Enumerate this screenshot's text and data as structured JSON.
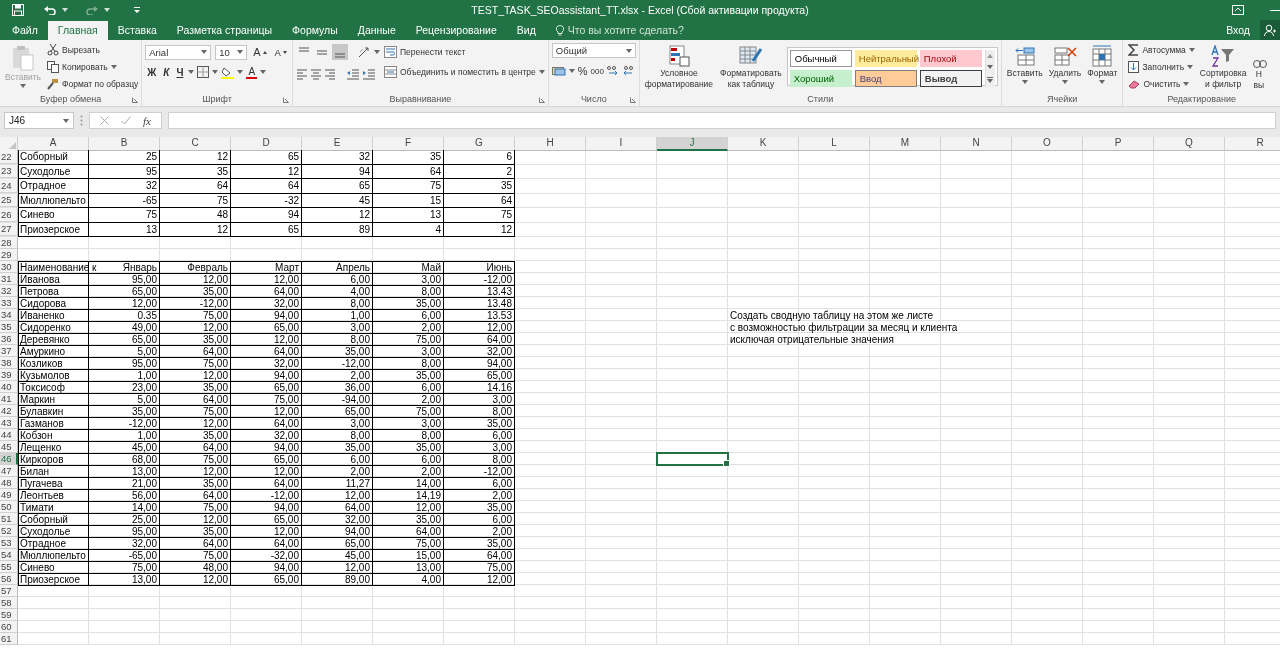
{
  "title_bar": {
    "title": "TEST_TASK_SEOassistant_TT.xlsx - Excel (Сбой активации продукта)"
  },
  "tabs": [
    {
      "label": "Файл",
      "selected": false
    },
    {
      "label": "Главная",
      "selected": true
    },
    {
      "label": "Вставка",
      "selected": false
    },
    {
      "label": "Разметка страницы",
      "selected": false
    },
    {
      "label": "Формулы",
      "selected": false
    },
    {
      "label": "Данные",
      "selected": false
    },
    {
      "label": "Рецензирование",
      "selected": false
    },
    {
      "label": "Вид",
      "selected": false
    }
  ],
  "tell_me": {
    "placeholder": "Что вы хотите сделать?"
  },
  "sign_in": "Вход",
  "ribbon": {
    "clipboard": {
      "paste": {
        "label": "Вставить",
        "disabled": true
      },
      "cut": "Вырезать",
      "copy": "Копировать",
      "format_painter": "Формат по образцу",
      "group_label": "Буфер обмена"
    },
    "font": {
      "name": "Arial",
      "size": "10",
      "grow": "A",
      "shrink": "A",
      "bold": "Ж",
      "italic": "К",
      "underline": "Ч",
      "font_color": "A",
      "group_label": "Шрифт"
    },
    "alignment": {
      "vertical_buttons": [
        {
          "selected": false
        },
        {
          "selected": false
        },
        {
          "selected": true
        }
      ],
      "wrap_text": "Перенести текст",
      "merge_center": "Объединить и поместить в центре",
      "group_label": "Выравнивание"
    },
    "number": {
      "format": "Общий",
      "percent": "%",
      "thousands": "000",
      "group_label": "Число"
    },
    "styles": {
      "conditional": "Условное\nформатирование",
      "format_table": "Форматировать\nкак таблицу",
      "cell_styles": [
        {
          "label": "Обычный",
          "kind": "normal"
        },
        {
          "label": "Нейтральный",
          "kind": "neutral"
        },
        {
          "label": "Плохой",
          "kind": "bad"
        },
        {
          "label": "Хороший",
          "kind": "good"
        },
        {
          "label": "Ввод",
          "kind": "input"
        },
        {
          "label": "Вывод",
          "kind": "output"
        }
      ],
      "group_label": "Стили"
    },
    "cells": {
      "insert": "Вставить",
      "delete": "Удалить",
      "format": "Формат",
      "group_label": "Ячейки"
    },
    "editing": {
      "autosum": "Автосумма",
      "fill": "Заполнить",
      "clear": "Очистить",
      "sort_filter": "Сортировка\nи фильтр",
      "find_select": "Н\nвы",
      "group_label": "Редактирование"
    }
  },
  "formula_bar": {
    "name_box": "J46",
    "function_label": "fx"
  },
  "sheet": {
    "columns": [
      {
        "label": "A",
        "selected": false
      },
      {
        "label": "B",
        "selected": false
      },
      {
        "label": "C",
        "selected": false
      },
      {
        "label": "D",
        "selected": false
      },
      {
        "label": "E",
        "selected": false
      },
      {
        "label": "F",
        "selected": false
      },
      {
        "label": "G",
        "selected": false
      },
      {
        "label": "H",
        "selected": false
      },
      {
        "label": "I",
        "selected": false
      },
      {
        "label": "J",
        "selected": true
      },
      {
        "label": "K",
        "selected": false
      },
      {
        "label": "L",
        "selected": false
      },
      {
        "label": "M",
        "selected": false
      },
      {
        "label": "N",
        "selected": false
      },
      {
        "label": "O",
        "selected": false
      },
      {
        "label": "P",
        "selected": false
      },
      {
        "label": "Q",
        "selected": false
      },
      {
        "label": "R",
        "selected": false
      }
    ],
    "rows": [
      {
        "number": "22",
        "kind": "block",
        "selected": false,
        "cells": {
          "A": "Соборный",
          "B": "25",
          "C": "12",
          "D": "65",
          "E": "32",
          "F": "35",
          "G": "6"
        }
      },
      {
        "number": "23",
        "kind": "block",
        "selected": false,
        "cells": {
          "A": "Суходолье",
          "B": "95",
          "C": "35",
          "D": "12",
          "E": "94",
          "F": "64",
          "G": "2"
        }
      },
      {
        "number": "24",
        "kind": "block",
        "selected": false,
        "cells": {
          "A": "Отрадное",
          "B": "32",
          "C": "64",
          "D": "64",
          "E": "65",
          "F": "75",
          "G": "35"
        }
      },
      {
        "number": "25",
        "kind": "block",
        "selected": false,
        "cells": {
          "A": "Мюллюпельто",
          "B": "-65",
          "C": "75",
          "D": "-32",
          "E": "45",
          "F": "15",
          "G": "64"
        }
      },
      {
        "number": "26",
        "kind": "block",
        "selected": false,
        "cells": {
          "A": "Синево",
          "B": "75",
          "C": "48",
          "D": "94",
          "E": "12",
          "F": "13",
          "G": "75"
        }
      },
      {
        "number": "27",
        "kind": "block",
        "selected": false,
        "cells": {
          "A": "Приозерское",
          "B": "13",
          "C": "12",
          "D": "65",
          "E": "89",
          "F": "4",
          "G": "12"
        }
      },
      {
        "number": "28",
        "kind": "empty",
        "selected": false
      },
      {
        "number": "29",
        "kind": "empty",
        "selected": false
      },
      {
        "number": "30",
        "kind": "table",
        "selected": false,
        "cells": {
          "A": "Наименование к",
          "B": "Январь",
          "C": "Февраль",
          "D": "Март",
          "E": "Апрель",
          "F": "Май",
          "G": "Июнь"
        }
      },
      {
        "number": "31",
        "kind": "table",
        "selected": false,
        "cells": {
          "A": "Иванова",
          "B": "95,00",
          "C": "12,00",
          "D": "12,00",
          "E": "6,00",
          "F": "3,00",
          "G": "-12,00"
        }
      },
      {
        "number": "32",
        "kind": "table",
        "selected": false,
        "cells": {
          "A": "Петрова",
          "B": "65,00",
          "C": "35,00",
          "D": "64,00",
          "E": "4,00",
          "F": "8,00",
          "G": "13.43"
        }
      },
      {
        "number": "33",
        "kind": "table",
        "selected": false,
        "cells": {
          "A": "Сидорова",
          "B": "12,00",
          "C": "-12,00",
          "D": "32,00",
          "E": "8,00",
          "F": "35,00",
          "G": "13.48"
        }
      },
      {
        "number": "34",
        "kind": "table",
        "selected": false,
        "cells": {
          "A": "Иваненко",
          "B": "0.35",
          "C": "75,00",
          "D": "94,00",
          "E": "1,00",
          "F": "6,00",
          "G": "13.53",
          "K": "Создать сводную таблицу на этом же листе"
        }
      },
      {
        "number": "35",
        "kind": "table",
        "selected": false,
        "cells": {
          "A": "Сидоренко",
          "B": "49,00",
          "C": "12,00",
          "D": "65,00",
          "E": "3,00",
          "F": "2,00",
          "G": "12,00",
          "K": "с возможностью фильтрации за месяц и клиента"
        }
      },
      {
        "number": "36",
        "kind": "table",
        "selected": false,
        "cells": {
          "A": "Деревянко",
          "B": "65,00",
          "C": "35,00",
          "D": "12,00",
          "E": "8,00",
          "F": "75,00",
          "G": "64,00",
          "K": "исключая отрицательные значения"
        }
      },
      {
        "number": "37",
        "kind": "table",
        "selected": false,
        "cells": {
          "A": "Амуркино",
          "B": "5,00",
          "C": "64,00",
          "D": "64,00",
          "E": "35,00",
          "F": "3,00",
          "G": "32,00"
        }
      },
      {
        "number": "38",
        "kind": "table",
        "selected": false,
        "cells": {
          "A": "Козликов",
          "B": "95,00",
          "C": "75,00",
          "D": "32,00",
          "E": "-12,00",
          "F": "8,00",
          "G": "94,00"
        }
      },
      {
        "number": "39",
        "kind": "table",
        "selected": false,
        "cells": {
          "A": "Кузьмолов",
          "B": "1,00",
          "C": "12,00",
          "D": "94,00",
          "E": "2,00",
          "F": "35,00",
          "G": "65,00"
        }
      },
      {
        "number": "40",
        "kind": "table",
        "selected": false,
        "cells": {
          "A": "Токсисоф",
          "B": "23,00",
          "C": "35,00",
          "D": "65,00",
          "E": "36,00",
          "F": "6,00",
          "G": "14.16"
        }
      },
      {
        "number": "41",
        "kind": "table",
        "selected": false,
        "cells": {
          "A": "Маркин",
          "B": "5,00",
          "C": "64,00",
          "D": "75,00",
          "E": "-94,00",
          "F": "2,00",
          "G": "3,00"
        }
      },
      {
        "number": "42",
        "kind": "table",
        "selected": false,
        "cells": {
          "A": "Булавкин",
          "B": "35,00",
          "C": "75,00",
          "D": "12,00",
          "E": "65,00",
          "F": "75,00",
          "G": "8,00"
        }
      },
      {
        "number": "43",
        "kind": "table",
        "selected": false,
        "cells": {
          "A": "Газманов",
          "B": "-12,00",
          "C": "12,00",
          "D": "64,00",
          "E": "3,00",
          "F": "3,00",
          "G": "35,00"
        }
      },
      {
        "number": "44",
        "kind": "table",
        "selected": false,
        "cells": {
          "A": "Кобзон",
          "B": "1,00",
          "C": "35,00",
          "D": "32,00",
          "E": "8,00",
          "F": "8,00",
          "G": "6,00"
        }
      },
      {
        "number": "45",
        "kind": "table",
        "selected": false,
        "cells": {
          "A": "Лещенко",
          "B": "45,00",
          "C": "64,00",
          "D": "94,00",
          "E": "35,00",
          "F": "35,00",
          "G": "3,00"
        }
      },
      {
        "number": "46",
        "kind": "table",
        "selected": true,
        "cells": {
          "A": "Киркоров",
          "B": "68,00",
          "C": "75,00",
          "D": "65,00",
          "E": "6,00",
          "F": "6,00",
          "G": "8,00"
        }
      },
      {
        "number": "47",
        "kind": "table",
        "selected": false,
        "cells": {
          "A": "Билан",
          "B": "13,00",
          "C": "12,00",
          "D": "12,00",
          "E": "2,00",
          "F": "2,00",
          "G": "-12,00"
        }
      },
      {
        "number": "48",
        "kind": "table",
        "selected": false,
        "cells": {
          "A": "Пугачева",
          "B": "21,00",
          "C": "35,00",
          "D": "64,00",
          "E": "11,27",
          "F": "14,00",
          "G": "6,00"
        }
      },
      {
        "number": "49",
        "kind": "table",
        "selected": false,
        "cells": {
          "A": "Леонтьев",
          "B": "56,00",
          "C": "64,00",
          "D": "-12,00",
          "E": "12,00",
          "F": "14,19",
          "G": "2,00"
        }
      },
      {
        "number": "50",
        "kind": "table",
        "selected": false,
        "cells": {
          "A": "Тимати",
          "B": "14,00",
          "C": "75,00",
          "D": "94,00",
          "E": "64,00",
          "F": "12,00",
          "G": "35,00"
        }
      },
      {
        "number": "51",
        "kind": "table",
        "selected": false,
        "cells": {
          "A": "Соборный",
          "B": "25,00",
          "C": "12,00",
          "D": "65,00",
          "E": "32,00",
          "F": "35,00",
          "G": "6,00"
        }
      },
      {
        "number": "52",
        "kind": "table",
        "selected": false,
        "cells": {
          "A": "Суходолье",
          "B": "95,00",
          "C": "35,00",
          "D": "12,00",
          "E": "94,00",
          "F": "64,00",
          "G": "2,00"
        }
      },
      {
        "number": "53",
        "kind": "table",
        "selected": false,
        "cells": {
          "A": "Отрадное",
          "B": "32,00",
          "C": "64,00",
          "D": "64,00",
          "E": "65,00",
          "F": "75,00",
          "G": "35,00"
        }
      },
      {
        "number": "54",
        "kind": "table",
        "selected": false,
        "cells": {
          "A": "Мюллюпельто",
          "B": "-65,00",
          "C": "75,00",
          "D": "-32,00",
          "E": "45,00",
          "F": "15,00",
          "G": "64,00"
        }
      },
      {
        "number": "55",
        "kind": "table",
        "selected": false,
        "cells": {
          "A": "Синево",
          "B": "75,00",
          "C": "48,00",
          "D": "94,00",
          "E": "12,00",
          "F": "13,00",
          "G": "75,00"
        }
      },
      {
        "number": "56",
        "kind": "table",
        "selected": false,
        "cells": {
          "A": "Приозерское",
          "B": "13,00",
          "C": "12,00",
          "D": "65,00",
          "E": "89,00",
          "F": "4,00",
          "G": "12,00"
        }
      },
      {
        "number": "57",
        "kind": "empty",
        "selected": false
      },
      {
        "number": "58",
        "kind": "empty",
        "selected": false
      },
      {
        "number": "59",
        "kind": "empty",
        "selected": false
      },
      {
        "number": "60",
        "kind": "empty",
        "selected": false
      },
      {
        "number": "61",
        "kind": "empty",
        "selected": false
      }
    ]
  }
}
